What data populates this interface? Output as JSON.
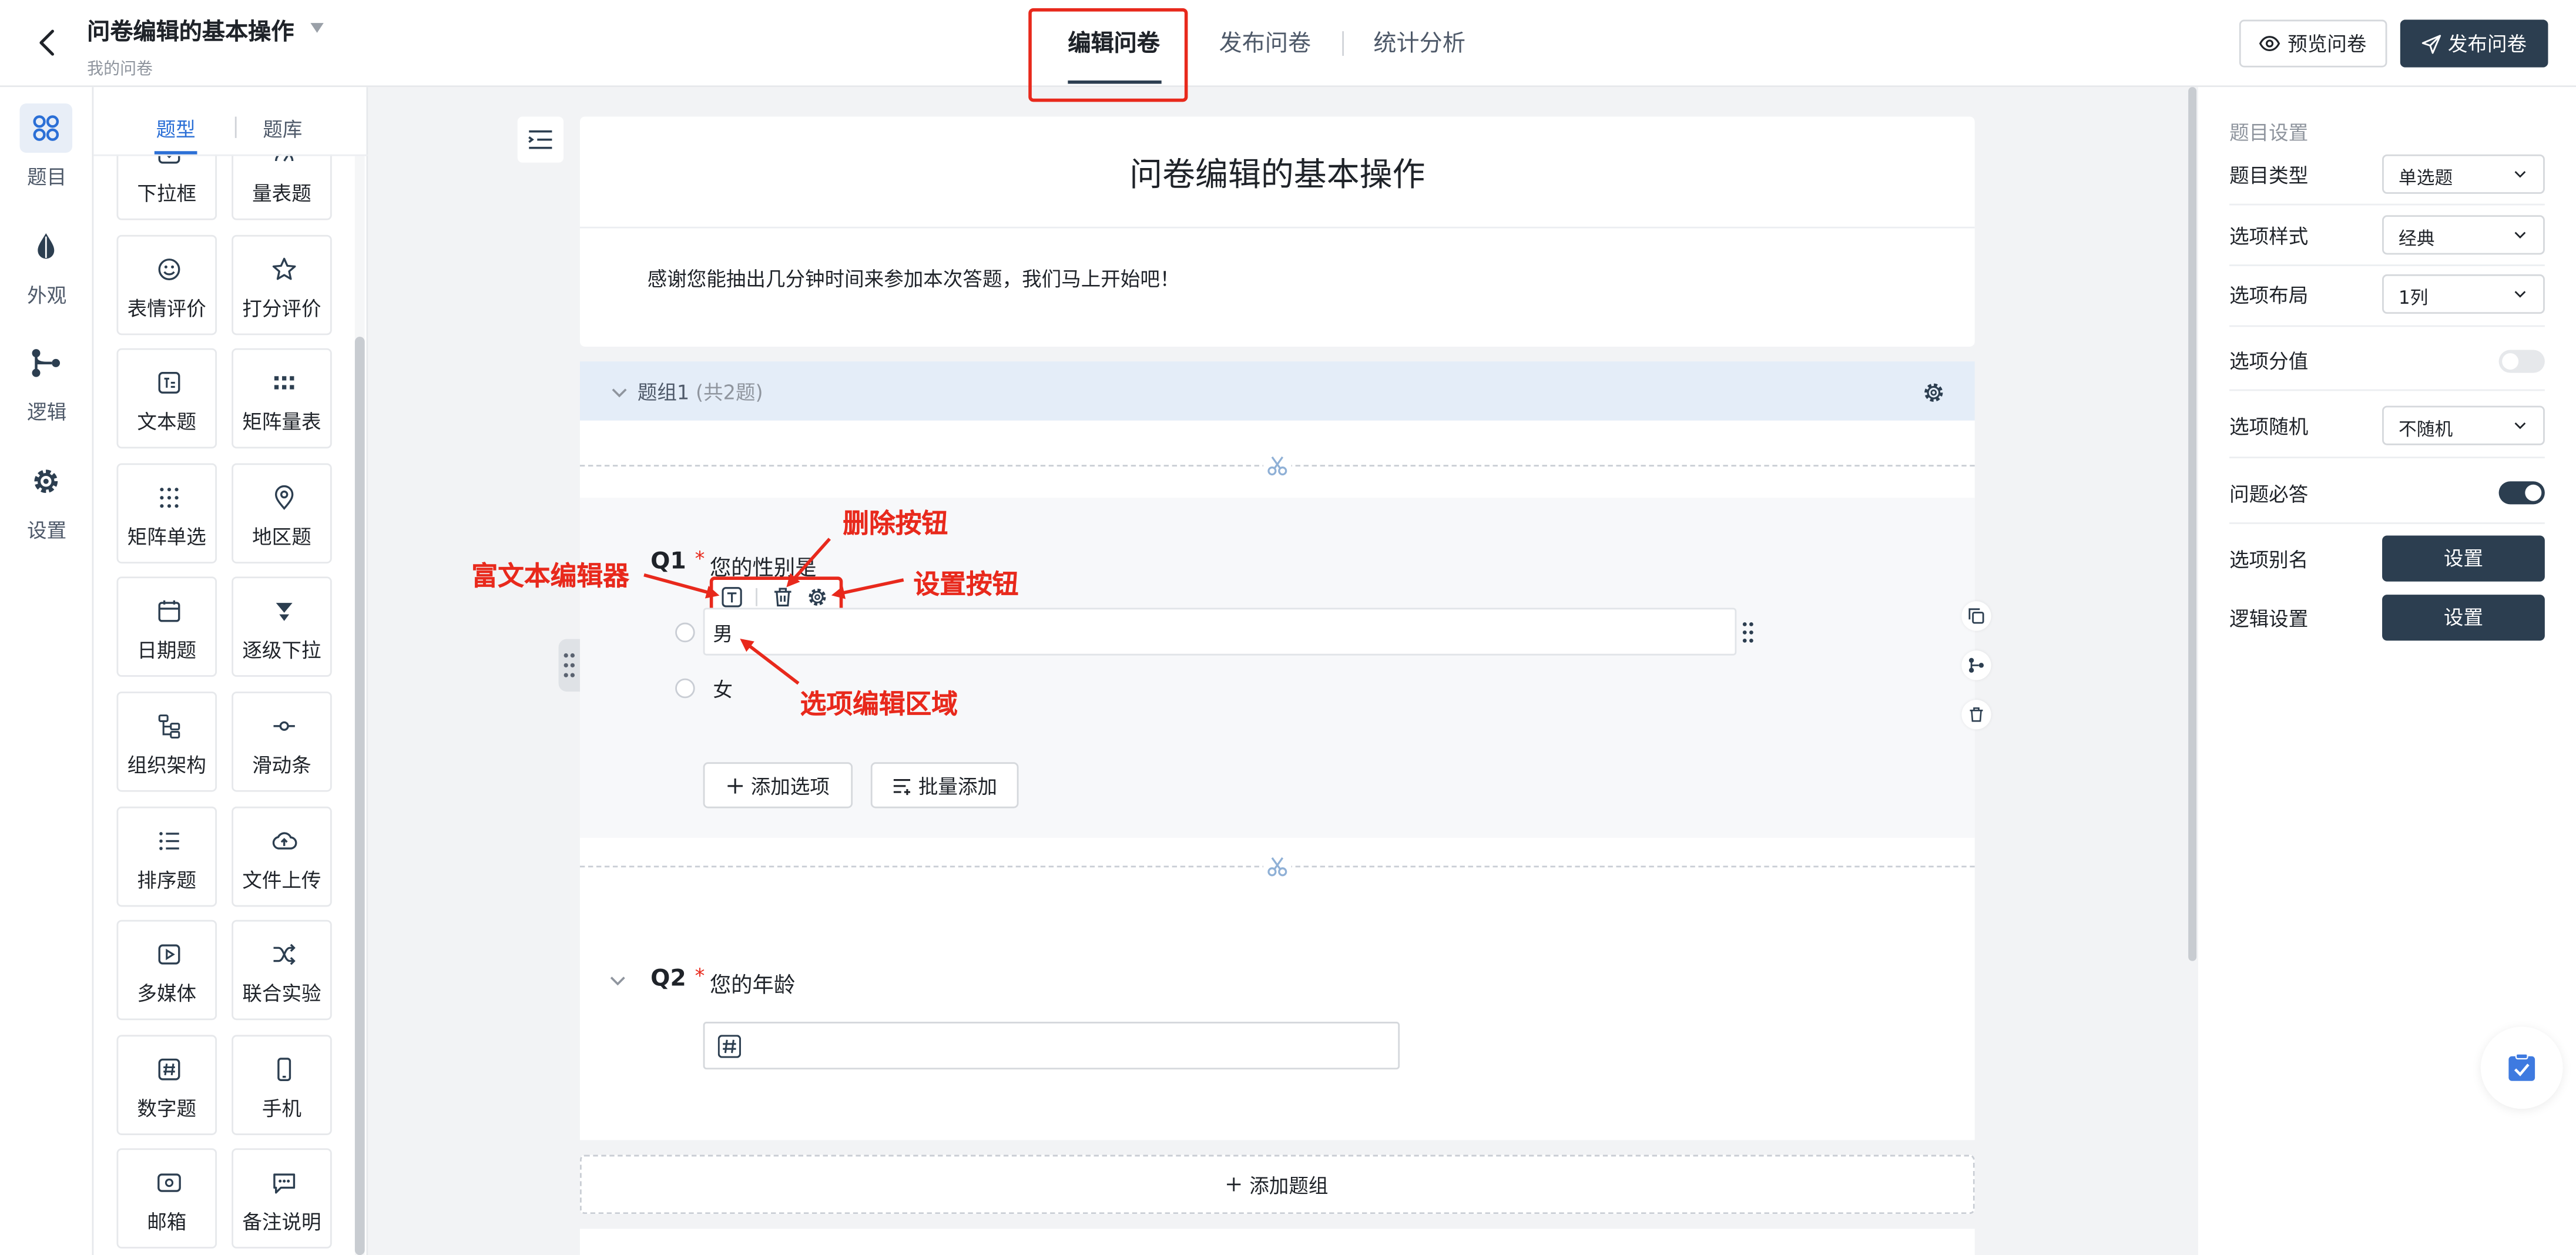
{
  "header": {
    "title": "问卷编辑的基本操作",
    "subtitle": "我的问卷",
    "tabs": [
      {
        "label": "编辑问卷"
      },
      {
        "label": "发布问卷"
      },
      {
        "label": "统计分析"
      }
    ],
    "preview_label": "预览问卷",
    "publish_label": "发布问卷"
  },
  "rail": {
    "items": [
      {
        "label": "题目",
        "icon": "grid-icon"
      },
      {
        "label": "外观",
        "icon": "drop-icon"
      },
      {
        "label": "逻辑",
        "icon": "branch-icon"
      },
      {
        "label": "设置",
        "icon": "gear-icon"
      }
    ]
  },
  "types_panel": {
    "tabs": [
      {
        "label": "题型"
      },
      {
        "label": "题库"
      }
    ],
    "items": [
      {
        "label": "下拉框",
        "icon": "dropdown-icon"
      },
      {
        "label": "量表题",
        "icon": "scale-icon"
      },
      {
        "label": "表情评价",
        "icon": "smile-icon"
      },
      {
        "label": "打分评价",
        "icon": "star-icon"
      },
      {
        "label": "文本题",
        "icon": "text-icon"
      },
      {
        "label": "矩阵量表",
        "icon": "matrix-scale-icon"
      },
      {
        "label": "矩阵单选",
        "icon": "matrix-radio-icon"
      },
      {
        "label": "地区题",
        "icon": "location-icon"
      },
      {
        "label": "日期题",
        "icon": "calendar-icon"
      },
      {
        "label": "逐级下拉",
        "icon": "cascade-icon"
      },
      {
        "label": "组织架构",
        "icon": "org-icon"
      },
      {
        "label": "滑动条",
        "icon": "slider-icon"
      },
      {
        "label": "排序题",
        "icon": "sort-icon"
      },
      {
        "label": "文件上传",
        "icon": "upload-icon"
      },
      {
        "label": "多媒体",
        "icon": "media-icon"
      },
      {
        "label": "联合实验",
        "icon": "shuffle-icon"
      },
      {
        "label": "数字题",
        "icon": "hash-icon"
      },
      {
        "label": "手机",
        "icon": "phone-icon"
      },
      {
        "label": "邮箱",
        "icon": "mail-icon"
      },
      {
        "label": "备注说明",
        "icon": "comment-icon"
      }
    ]
  },
  "survey": {
    "title": "问卷编辑的基本操作",
    "intro": "感谢您能抽出几分钟时间来参加本次答题，我们马上开始吧！",
    "group": {
      "name": "题组1",
      "count": "(共2题)"
    },
    "q1": {
      "number": "Q1",
      "required": "*",
      "text": "您的性别是",
      "options": [
        "男",
        "女"
      ],
      "add_option": "添加选项",
      "batch_add": "批量添加"
    },
    "q2": {
      "number": "Q2",
      "required": "*",
      "text": "您的年龄",
      "input_icon": "hash-icon"
    },
    "add_group": "添加题组"
  },
  "annotations": {
    "rich_text": "富文本编辑器",
    "delete": "删除按钮",
    "settings": "设置按钮",
    "option_area": "选项编辑区域"
  },
  "settings": {
    "title": "题目设置",
    "type": {
      "label": "题目类型",
      "value": "单选题"
    },
    "style": {
      "label": "选项样式",
      "value": "经典"
    },
    "layout": {
      "label": "选项布局",
      "value": "1列"
    },
    "score": {
      "label": "选项分值",
      "on": false
    },
    "random": {
      "label": "选项随机",
      "value": "不随机"
    },
    "required": {
      "label": "问题必答",
      "on": true
    },
    "alias": {
      "label": "选项别名",
      "button": "设置"
    },
    "logic": {
      "label": "逻辑设置",
      "button": "设置"
    }
  },
  "colors": {
    "primary": "#2c3e50",
    "accent": "#2b6fd6",
    "annotation": "#e8291c",
    "group_bar": "#e4edf8"
  }
}
